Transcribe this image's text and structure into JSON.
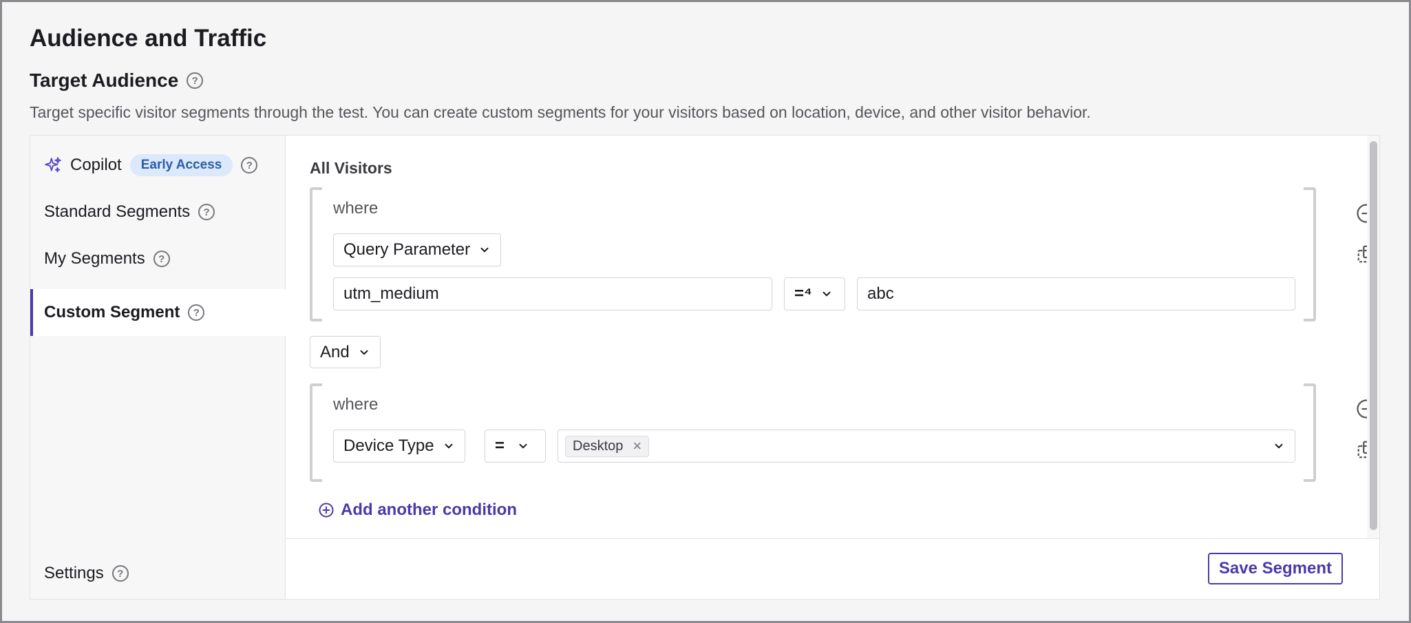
{
  "page": {
    "title": "Audience and Traffic"
  },
  "target_audience": {
    "title": "Target Audience",
    "description": "Target specific visitor segments through the test. You can create custom segments for your visitors based on location, device, and other visitor behavior."
  },
  "sidebar": {
    "items": [
      {
        "label": "Copilot",
        "badge": "Early Access",
        "icon": "sparkle-icon"
      },
      {
        "label": "Standard Segments"
      },
      {
        "label": "My Segments"
      },
      {
        "label": "Custom Segment",
        "active": true
      }
    ],
    "settings_label": "Settings"
  },
  "segment": {
    "heading": "All Visitors",
    "groups": [
      {
        "where_label": "where",
        "attribute": "Query Parameter",
        "param_name": "utm_medium",
        "operator": "=⁴",
        "value": "abc"
      },
      {
        "where_label": "where",
        "attribute": "Device Type",
        "operator": "=",
        "chips": [
          "Desktop"
        ]
      }
    ],
    "joiner": "And",
    "add_condition_label": "Add another condition",
    "save_label": "Save Segment"
  },
  "colors": {
    "accent": "#4a3aa8",
    "badge_bg": "#dbe9fb",
    "badge_text": "#2a5da8"
  }
}
